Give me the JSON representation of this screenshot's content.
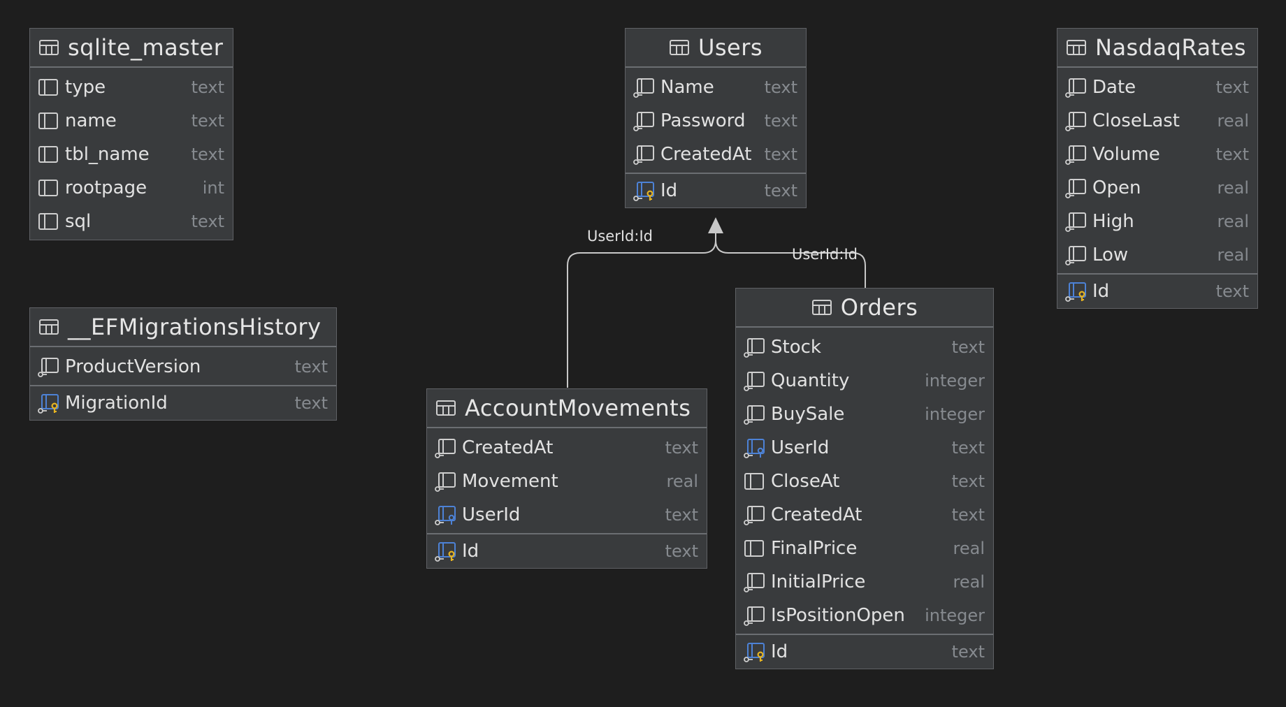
{
  "tables": {
    "sqlite_master": {
      "title": "sqlite_master",
      "columns": [
        {
          "name": "type",
          "type": "text",
          "icon": "column-icon"
        },
        {
          "name": "name",
          "type": "text",
          "icon": "column-icon"
        },
        {
          "name": "tbl_name",
          "type": "text",
          "icon": "column-icon"
        },
        {
          "name": "rootpage",
          "type": "int",
          "icon": "column-icon"
        },
        {
          "name": "sql",
          "type": "text",
          "icon": "column-icon"
        }
      ]
    },
    "users": {
      "title": "Users",
      "columns": [
        {
          "name": "Name",
          "type": "text",
          "icon": "not-null-column-icon"
        },
        {
          "name": "Password",
          "type": "text",
          "icon": "not-null-column-icon"
        },
        {
          "name": "CreatedAt",
          "type": "text",
          "icon": "not-null-column-icon"
        }
      ],
      "pk": {
        "name": "Id",
        "type": "text",
        "icon": "primary-key-icon"
      }
    },
    "nasdaq": {
      "title": "NasdaqRates",
      "columns": [
        {
          "name": "Date",
          "type": "text",
          "icon": "not-null-column-icon"
        },
        {
          "name": "CloseLast",
          "type": "real",
          "icon": "not-null-column-icon"
        },
        {
          "name": "Volume",
          "type": "text",
          "icon": "not-null-column-icon"
        },
        {
          "name": "Open",
          "type": "real",
          "icon": "not-null-column-icon"
        },
        {
          "name": "High",
          "type": "real",
          "icon": "not-null-column-icon"
        },
        {
          "name": "Low",
          "type": "real",
          "icon": "not-null-column-icon"
        }
      ],
      "pk": {
        "name": "Id",
        "type": "text",
        "icon": "primary-key-icon"
      }
    },
    "migrations": {
      "title": "__EFMigrationsHistory",
      "columns": [
        {
          "name": "ProductVersion",
          "type": "text",
          "icon": "not-null-column-icon"
        }
      ],
      "pk": {
        "name": "MigrationId",
        "type": "text",
        "icon": "primary-key-icon"
      }
    },
    "account": {
      "title": "AccountMovements",
      "columns": [
        {
          "name": "CreatedAt",
          "type": "text",
          "icon": "not-null-column-icon"
        },
        {
          "name": "Movement",
          "type": "real",
          "icon": "not-null-column-icon"
        },
        {
          "name": "UserId",
          "type": "text",
          "icon": "foreign-key-icon"
        }
      ],
      "pk": {
        "name": "Id",
        "type": "text",
        "icon": "primary-key-icon"
      }
    },
    "orders": {
      "title": "Orders",
      "columns": [
        {
          "name": "Stock",
          "type": "text",
          "icon": "not-null-column-icon"
        },
        {
          "name": "Quantity",
          "type": "integer",
          "icon": "not-null-column-icon"
        },
        {
          "name": "BuySale",
          "type": "integer",
          "icon": "not-null-column-icon"
        },
        {
          "name": "UserId",
          "type": "text",
          "icon": "foreign-key-icon"
        },
        {
          "name": "CloseAt",
          "type": "text",
          "icon": "column-icon"
        },
        {
          "name": "CreatedAt",
          "type": "text",
          "icon": "not-null-column-icon"
        },
        {
          "name": "FinalPrice",
          "type": "real",
          "icon": "column-icon"
        },
        {
          "name": "InitialPrice",
          "type": "real",
          "icon": "not-null-column-icon"
        },
        {
          "name": "IsPositionOpen",
          "type": "integer",
          "icon": "not-null-column-icon"
        }
      ],
      "pk": {
        "name": "Id",
        "type": "text",
        "icon": "pk-fk-icon"
      }
    }
  },
  "relations": [
    {
      "label": "UserId:Id",
      "from": "AccountMovements",
      "to": "Users"
    },
    {
      "label": "UserId:Id",
      "from": "Orders",
      "to": "Users"
    }
  ],
  "colors": {
    "background": "#1e1e1e",
    "table_fill": "#393b3d",
    "key_gold": "#e6b422",
    "key_blue": "#4d82d6"
  }
}
